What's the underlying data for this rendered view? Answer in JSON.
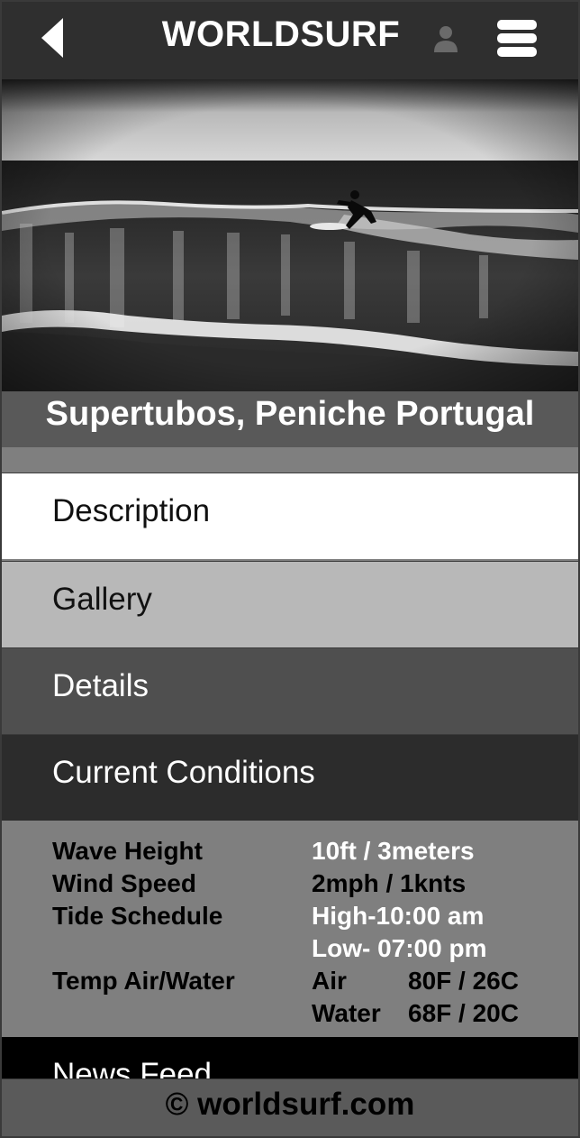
{
  "header": {
    "brand": "WORLDSURF",
    "back_icon": "back-arrow-icon",
    "user_icon": "user-icon",
    "menu_icon": "hamburger-menu-icon"
  },
  "spot": {
    "title": "Supertubos, Peniche Portugal"
  },
  "tabs": [
    {
      "label": "Description"
    },
    {
      "label": "Gallery"
    },
    {
      "label": "Details"
    },
    {
      "label": "Current Conditions"
    }
  ],
  "conditions": {
    "wave_height": {
      "label": "Wave Height",
      "value": "10ft / 3meters"
    },
    "wind_speed": {
      "label": "Wind Speed",
      "value": "2mph / 1knts"
    },
    "tide_schedule": {
      "label": "Tide Schedule",
      "high": "High-10:00 am",
      "low": "Low- 07:00 pm"
    },
    "temp": {
      "label": "Temp Air/Water",
      "air_label": "Air",
      "air_value": "80F / 26C",
      "water_label": "Water",
      "water_value": "68F / 20C"
    }
  },
  "news": {
    "label": "News Feed"
  },
  "footer": {
    "text": "© worldsurf.com"
  },
  "colors": {
    "header_bg": "#2f2f2f",
    "page_bg": "#7f7f7f",
    "title_bar_bg": "#595959",
    "tab_active_bg": "#ffffff",
    "tab_gallery_bg": "#b8b8b8",
    "tab_details_bg": "#4f4f4f",
    "tab_current_bg": "#2c2c2c",
    "news_bg": "#000000"
  }
}
